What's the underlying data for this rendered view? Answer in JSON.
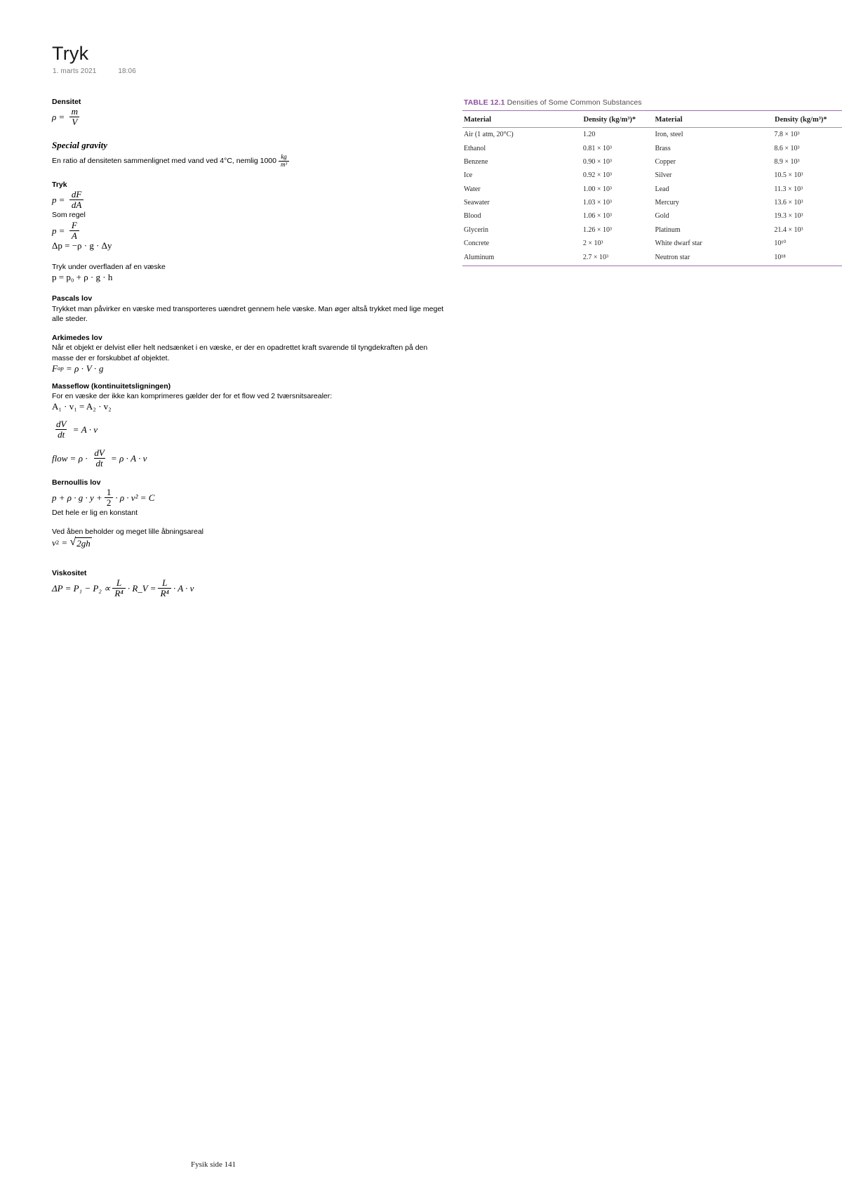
{
  "document": {
    "title": "Tryk",
    "date": "1. marts 2021",
    "time": "18:06",
    "footer": "Fysik side 141"
  },
  "sections": {
    "densitet": {
      "heading": "Densitet",
      "formula_lhs": "ρ",
      "formula_eq": "=",
      "frac_num": "m",
      "frac_den": "V"
    },
    "special_gravity": {
      "heading": "Special gravity",
      "text_before": "En ratio af densiteten sammenlignet med vand ved 4°C, nemlig 1000",
      "unit_num": "kg",
      "unit_den": "m³"
    },
    "tryk": {
      "heading": "Tryk",
      "f1_lhs": "p",
      "f1_num": "dF",
      "f1_den": "dA",
      "note": "Som regel",
      "f2_lhs": "p",
      "f2_num": "F",
      "f2_den": "A",
      "f3": "Δp = −ρ · g · Δy"
    },
    "tryk_under": {
      "text": "Tryk under overfladen af en væske",
      "formula": "p = p₀ + ρ · g · h"
    },
    "pascals": {
      "heading": "Pascals lov",
      "text": "Trykket man påvirker en væske med transporteres uændret gennem hele væske. Man øger altså trykket med lige meget alle steder."
    },
    "arkimedes": {
      "heading": "Arkimedes lov",
      "text": "Når et objekt er delvist eller helt nedsænket i en væske, er der en opadrettet kraft svarende til tyngdekraften på den masse der er forskubbet af objektet.",
      "formula": "F_op = ρ · V · g"
    },
    "masseflow": {
      "heading": "Masseflow (kontinuitetsligningen)",
      "text": "For en væske der ikke kan komprimeres gælder der for et flow ved 2 tværsnitsarealer:",
      "formula1": "A₁ · v₁ = A₂ · v₂",
      "f2_num": "dV",
      "f2_den": "dt",
      "f2_rhs": "A · v",
      "f3_lhs": "flow",
      "f3_rho": "ρ",
      "f3_num": "dV",
      "f3_den": "dt",
      "f3_rhs": "ρ · A · v"
    },
    "bernoulli": {
      "heading": "Bernoullis lov",
      "formula_a": "p + ρ · g · y +",
      "half_num": "1",
      "half_den": "2",
      "formula_b": "· ρ · v² = C",
      "note": "Det hele er lig en konstant",
      "open_text": "Ved åben beholder og meget lille åbningsareal",
      "open_lhs": "v₂",
      "open_radicand": "2gh"
    },
    "viskositet": {
      "heading": "Viskositet",
      "f_lhs": "ΔP = P₁ − P₂ ∝",
      "f_num1": "L",
      "f_den1": "R⁴",
      "f_mid": "· R_V =",
      "f_num2": "L",
      "f_den2": "R⁴",
      "f_end": "· A · v"
    }
  },
  "table": {
    "label": "TABLE 12.1",
    "caption": "Densities of Some Common Substances",
    "accent_color": "#9b6fb0",
    "headers": [
      "Material",
      "Density (kg/m³)*",
      "Material",
      "Density (kg/m³)*"
    ],
    "rows": [
      {
        "material_left": "Air (1 atm, 20°C)",
        "density_left": "1.20",
        "material_right": "Iron, steel",
        "density_right": "7.8 × 10³"
      },
      {
        "material_left": "Ethanol",
        "density_left": "0.81 × 10³",
        "material_right": "Brass",
        "density_right": "8.6 × 10³"
      },
      {
        "material_left": "Benzene",
        "density_left": "0.90 × 10³",
        "material_right": "Copper",
        "density_right": "8.9 × 10³"
      },
      {
        "material_left": "Ice",
        "density_left": "0.92 × 10³",
        "material_right": "Silver",
        "density_right": "10.5 × 10³"
      },
      {
        "material_left": "Water",
        "density_left": "1.00 × 10³",
        "material_right": "Lead",
        "density_right": "11.3 × 10³"
      },
      {
        "material_left": "Seawater",
        "density_left": "1.03 × 10³",
        "material_right": "Mercury",
        "density_right": "13.6 × 10³"
      },
      {
        "material_left": "Blood",
        "density_left": "1.06 × 10³",
        "material_right": "Gold",
        "density_right": "19.3 × 10³"
      },
      {
        "material_left": "Glycerin",
        "density_left": "1.26 × 10³",
        "material_right": "Platinum",
        "density_right": "21.4 × 10³"
      },
      {
        "material_left": "Concrete",
        "density_left": "2 × 10³",
        "material_right": "White dwarf star",
        "density_right": "10¹⁰"
      },
      {
        "material_left": "Aluminum",
        "density_left": "2.7 × 10³",
        "material_right": "Neutron star",
        "density_right": "10¹⁸"
      }
    ]
  }
}
